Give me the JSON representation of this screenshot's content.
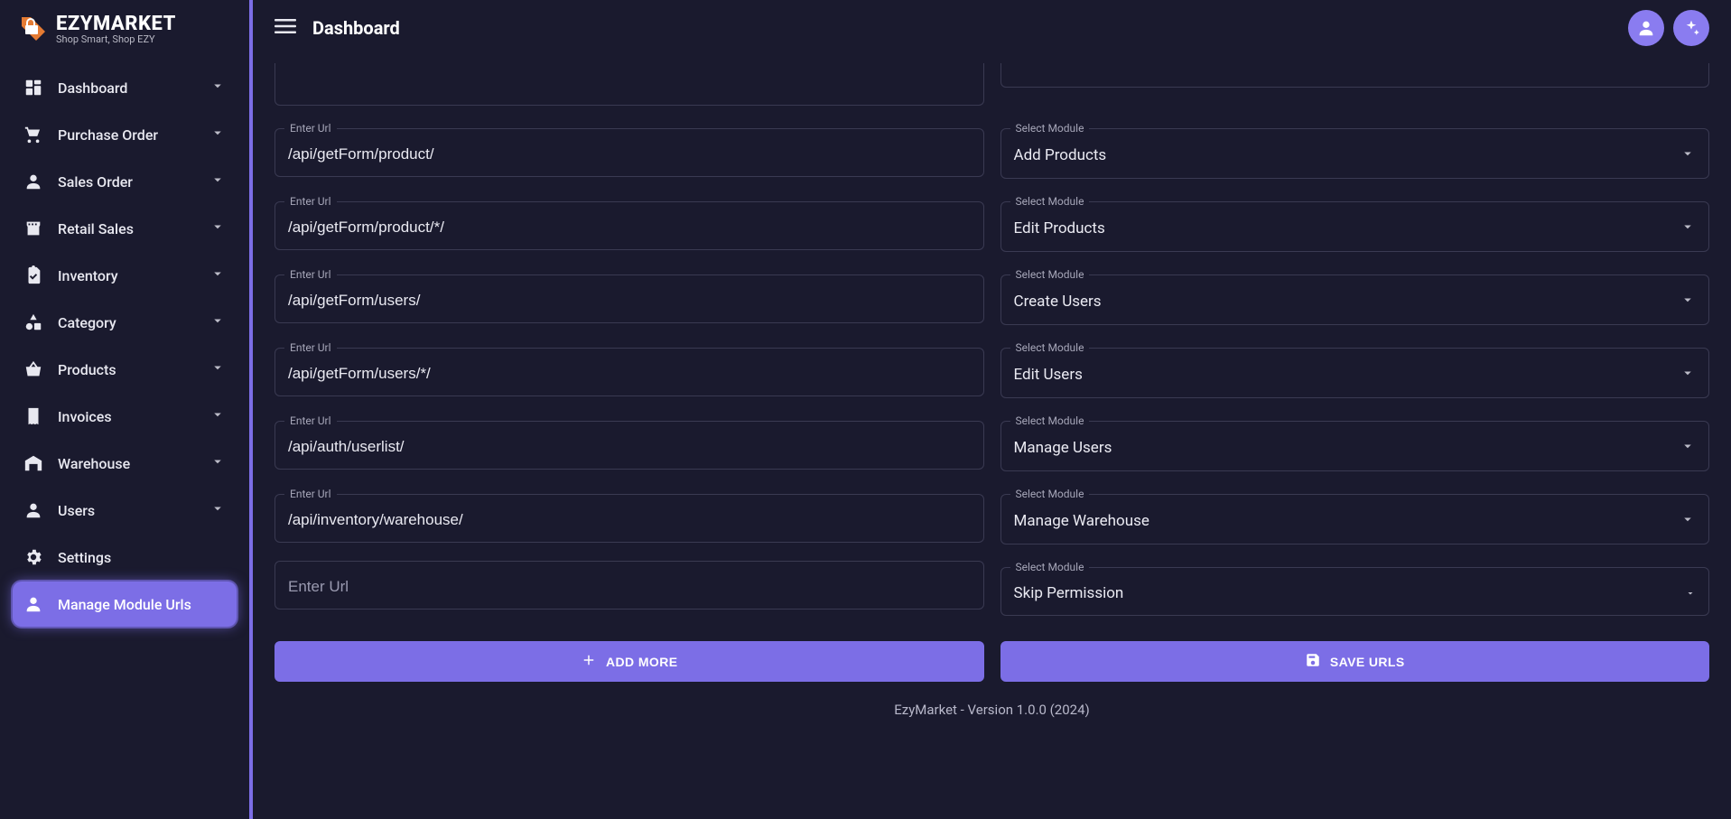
{
  "brand": {
    "title": "EZYMARKET",
    "tagline": "Shop Smart, Shop EZY"
  },
  "header": {
    "page_title": "Dashboard"
  },
  "sidebar": {
    "items": [
      {
        "icon": "dashboard",
        "label": "Dashboard",
        "expandable": true
      },
      {
        "icon": "cart",
        "label": "Purchase Order",
        "expandable": true
      },
      {
        "icon": "person",
        "label": "Sales Order",
        "expandable": true
      },
      {
        "icon": "store",
        "label": "Retail Sales",
        "expandable": true
      },
      {
        "icon": "clipboard",
        "label": "Inventory",
        "expandable": true
      },
      {
        "icon": "shapes",
        "label": "Category",
        "expandable": true
      },
      {
        "icon": "basket",
        "label": "Products",
        "expandable": true
      },
      {
        "icon": "receipt",
        "label": "Invoices",
        "expandable": true
      },
      {
        "icon": "warehouse",
        "label": "Warehouse",
        "expandable": true
      },
      {
        "icon": "person",
        "label": "Users",
        "expandable": true
      },
      {
        "icon": "gear",
        "label": "Settings",
        "expandable": false
      },
      {
        "icon": "person",
        "label": "Manage Module Urls",
        "expandable": false,
        "active": true
      }
    ]
  },
  "form": {
    "url_label": "Enter Url",
    "module_label": "Select Module",
    "rows": [
      {
        "url": "/api/getForm/product/",
        "module": "Add Products"
      },
      {
        "url": "/api/getForm/product/*/",
        "module": "Edit Products"
      },
      {
        "url": "/api/getForm/users/",
        "module": "Create Users"
      },
      {
        "url": "/api/getForm/users/*/",
        "module": "Edit Users"
      },
      {
        "url": "/api/auth/userlist/",
        "module": "Manage Users"
      },
      {
        "url": "/api/inventory/warehouse/",
        "module": "Manage Warehouse"
      }
    ],
    "empty_row": {
      "url_placeholder": "Enter Url",
      "module": "Skip Permission"
    },
    "add_label": "ADD MORE",
    "save_label": "SAVE URLS"
  },
  "footer": {
    "text": "EzyMarket - Version 1.0.0 (2024)"
  }
}
